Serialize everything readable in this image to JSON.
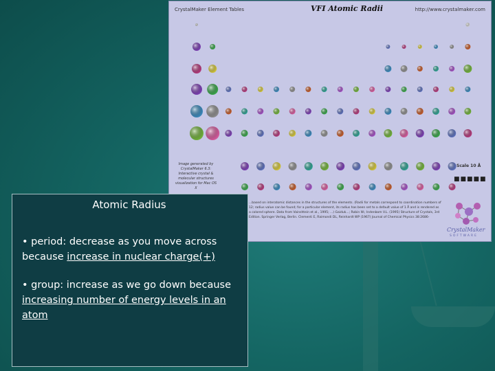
{
  "poster": {
    "brand": "CrystalMaker Element Tables",
    "title": "VFI Atomic Radii",
    "url": "http://www.crystalmaker.com",
    "blurb": "Image generated by CrystalMaker 6.3: Interactive crystal & molecular structures visualization for Mac OS X",
    "scale_label": "Scale 10 Å",
    "scale_dots": "■■■■■",
    "footnote": "...based on interatomic distances in the structures of the elements. (Radii for metals correspond to coordination numbers of 12; radius value can be found; for a particular element, its radius has been set to a default value of 1 Å and is rendered as a colored sphere. Data from Vainshtein et al., 1995; ...) Gaiduk...; Robin W.; Indenbom V.L. (1995) Structure of Crystals, 3rd Edition. Springer Verlag, Berlin. Clementi E, Raimondi DL, Reinhardt WP (1967) Journal of Chemical Physics 38:2686-",
    "logo_word": "CrystalMaker",
    "logo_sub": "SOFTWARE"
  },
  "slide": {
    "title": "Atomic Radius",
    "p1_prefix": "• period: decrease as you move across because ",
    "p1_underlined": "increase in nuclear charge(+)",
    "p2_prefix": "• group: increase as we go down because ",
    "p2_underlined": "increasing number of energy levels in an atom"
  }
}
